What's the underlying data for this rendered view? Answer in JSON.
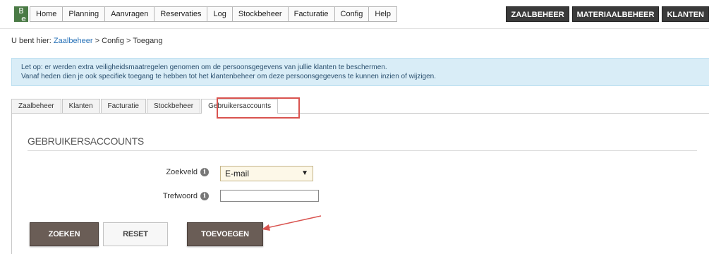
{
  "logo": {
    "line1": "B",
    "line2": "e"
  },
  "nav": [
    "Home",
    "Planning",
    "Aanvragen",
    "Reservaties",
    "Log",
    "Stockbeheer",
    "Facturatie",
    "Config",
    "Help"
  ],
  "modules": [
    "ZAALBEHEER",
    "MATERIAALBEHEER",
    "KLANTEN"
  ],
  "breadcrumb": {
    "prefix": "U bent hier: ",
    "link1": "Zaalbeheer",
    "sep1": " > ",
    "item2": "Config",
    "sep2": " > ",
    "item3": "Toegang"
  },
  "notice": {
    "line1": "Let op: er werden extra veiligheidsmaatregelen genomen om de persoonsgegevens van jullie klanten te beschermen.",
    "line2": "Vanaf heden dien je ook specifiek toegang te hebben tot het klantenbeheer om deze persoonsgegevens te kunnen inzien of wijzigen."
  },
  "tabs": [
    "Zaalbeheer",
    "Klanten",
    "Facturatie",
    "Stockbeheer",
    "Gebruikersaccounts"
  ],
  "active_tab": "Gebruikersaccounts",
  "section_title": "GEBRUIKERSACCOUNTS",
  "form": {
    "search_field_label": "Zoekveld",
    "search_field_value": "E-mail",
    "keyword_label": "Trefwoord",
    "keyword_value": ""
  },
  "buttons": {
    "search": "ZOEKEN",
    "reset": "RESET",
    "add": "TOEVOEGEN"
  },
  "colors": {
    "annotation": "#d9534f",
    "dark_button": "#6a5d56",
    "notice_bg": "#d9edf7"
  }
}
